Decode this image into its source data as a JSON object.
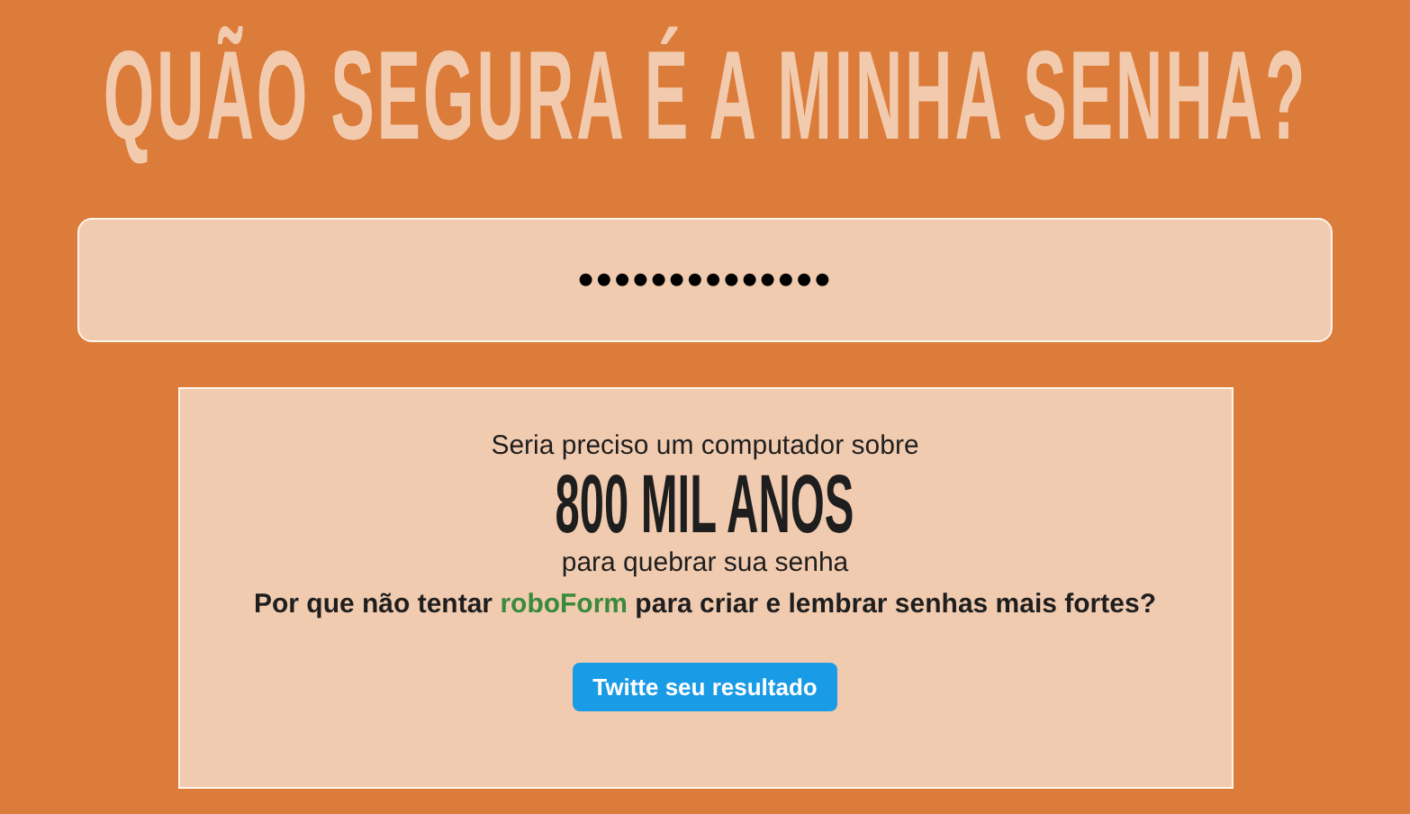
{
  "title": "QUÃO SEGURA É A MINHA SENHA?",
  "password_field": {
    "value": "••••••••••••••"
  },
  "result": {
    "intro": "Seria preciso um computador sobre",
    "duration": "800 MIL ANOS",
    "outro": "para quebrar sua senha",
    "question": [
      {
        "kind": "text",
        "text": "Por que não tentar "
      },
      {
        "kind": "link",
        "text": "roboForm"
      },
      {
        "kind": "text",
        "text": " para criar e lembrar senhas mais fortes?"
      }
    ],
    "share_button": "Twitte seu resultado"
  }
}
